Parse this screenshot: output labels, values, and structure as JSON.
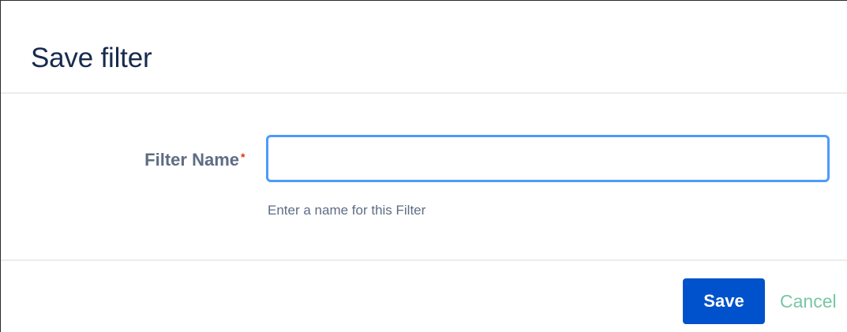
{
  "dialog": {
    "title": "Save filter"
  },
  "form": {
    "field_label": "Filter Name",
    "required_marker": "*",
    "input_value": "",
    "input_placeholder": "",
    "help_text": "Enter a name for this Filter"
  },
  "footer": {
    "save_label": "Save",
    "cancel_label": "Cancel"
  },
  "colors": {
    "primary_button": "#0052cc",
    "input_focus_border": "#4c9aff",
    "required": "#de350b",
    "cancel_link": "#79c6a5"
  }
}
